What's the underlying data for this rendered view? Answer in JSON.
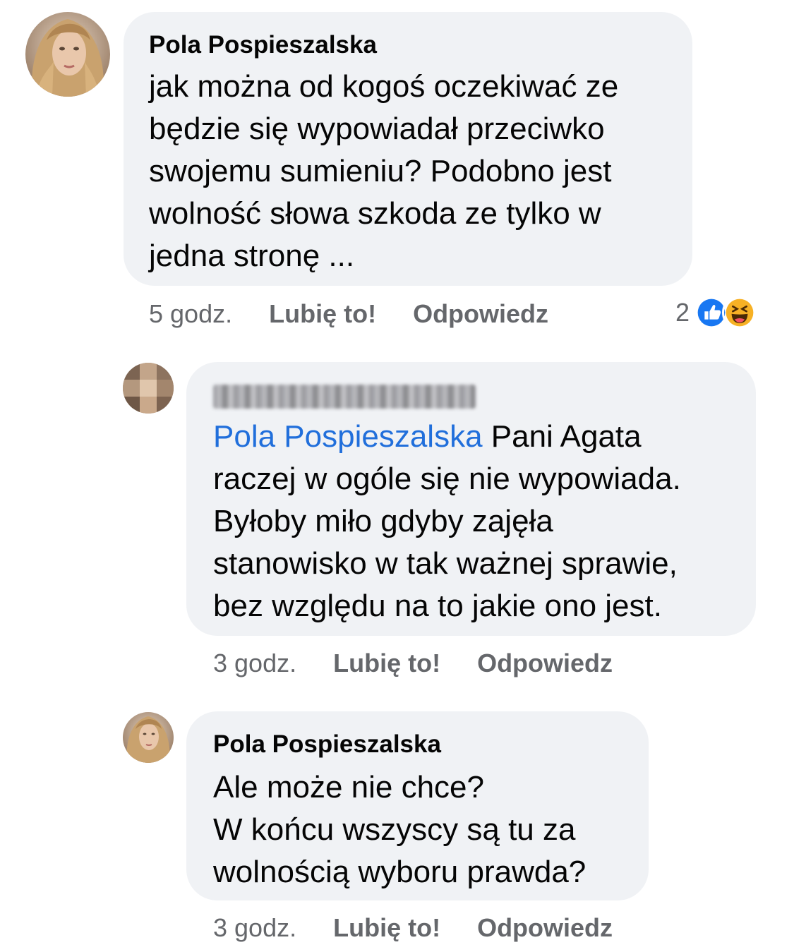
{
  "comments": [
    {
      "author": "Pola Pospieszalska",
      "text_lines": [
        "jak można od kogoś oczekiwać ze",
        "będzie się wypowiadał przeciwko",
        "swojemu sumieniu? Podobno jest",
        "wolność słowa szkoda ze tylko w",
        "jedna stronę ..."
      ],
      "time": "5 godz.",
      "like_label": "Lubię to!",
      "reply_label": "Odpowiedz",
      "reaction_count": "2",
      "reaction_icons": [
        "like-icon",
        "haha-icon"
      ]
    },
    {
      "author_blurred": true,
      "mention": "Pola Pospieszalska",
      "first_line_rest": " Pani Agata",
      "text_lines": [
        "raczej w ogóle się nie wypowiada.",
        "Byłoby miło gdyby zajęła",
        "stanowisko w tak ważnej sprawie,",
        "bez względu na to jakie ono jest."
      ],
      "time": "3 godz.",
      "like_label": "Lubię to!",
      "reply_label": "Odpowiedz"
    },
    {
      "author": "Pola Pospieszalska",
      "text_lines": [
        "Ale może nie chce?",
        "W końcu wszyscy są tu za",
        "wolnością wyboru prawda?"
      ],
      "time": "3 godz.",
      "like_label": "Lubię to!",
      "reply_label": "Odpowiedz"
    }
  ],
  "colors": {
    "bubble": "#f0f2f5",
    "mention": "#216fdb",
    "meta": "#65676b",
    "like_reaction": "#1877f2",
    "haha_reaction": "#f7b125"
  }
}
